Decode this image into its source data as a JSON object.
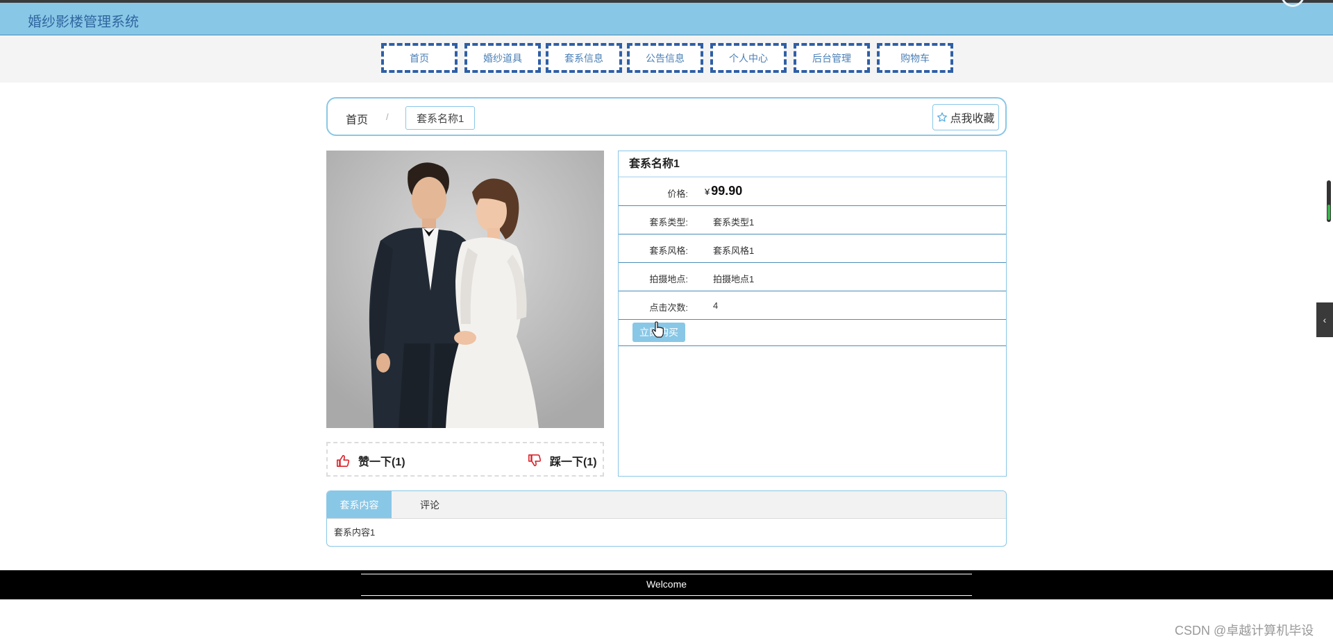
{
  "header": {
    "title": "婚纱影楼管理系统"
  },
  "nav": {
    "items": [
      "首页",
      "婚纱道具",
      "套系信息",
      "公告信息",
      "个人中心",
      "后台管理",
      "购物车"
    ]
  },
  "breadcrumb": {
    "home": "首页",
    "separator": "/",
    "current": "套系名称1"
  },
  "favorite": {
    "label": "点我收藏",
    "icon": "star-outline-icon"
  },
  "product": {
    "name": "套系名称1",
    "price_label": "价格:",
    "currency": "¥",
    "price": "99.90",
    "fields": [
      {
        "label": "套系类型:",
        "value": "套系类型1"
      },
      {
        "label": "套系风格:",
        "value": "套系风格1"
      },
      {
        "label": "拍摄地点:",
        "value": "拍摄地点1"
      },
      {
        "label": "点击次数:",
        "value": "4"
      }
    ],
    "buy_label": "立即购买"
  },
  "votes": {
    "like_label": "赞一下(1)",
    "dislike_label": "踩一下(1)"
  },
  "tabs": {
    "items": [
      "套系内容",
      "评论"
    ],
    "active": 0,
    "content": "套系内容1"
  },
  "footer": {
    "text": "Welcome"
  },
  "watermark": "CSDN @卓越计算机毕设",
  "colors": {
    "accent": "#89c7e6",
    "nav_border": "#2f5fa6",
    "title_text": "#2f67a0",
    "vote_icon": "#d9262e"
  }
}
